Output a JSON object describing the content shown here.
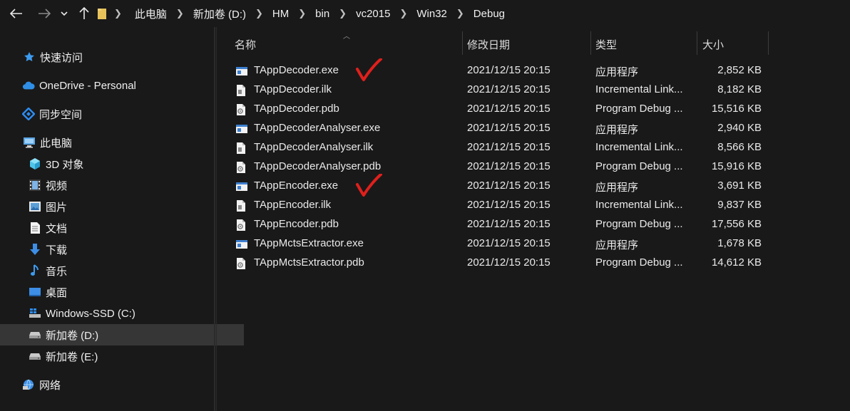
{
  "nav": {
    "back": "back-arrow-icon",
    "forward": "forward-arrow-icon",
    "recent": "chevron-down-icon",
    "up": "up-arrow-icon"
  },
  "breadcrumb": [
    "此电脑",
    "新加卷 (D:)",
    "HM",
    "bin",
    "vc2015",
    "Win32",
    "Debug"
  ],
  "sidebar": {
    "items": [
      {
        "label": "快速访问",
        "icon": "star-icon",
        "selected": false
      },
      {
        "label": "OneDrive - Personal",
        "icon": "cloud-icon",
        "selected": false
      },
      {
        "label": "同步空间",
        "icon": "sync-icon",
        "selected": false
      },
      {
        "label": "此电脑",
        "icon": "computer-icon",
        "selected": false
      },
      {
        "label": "3D 对象",
        "icon": "cube-icon",
        "selected": false
      },
      {
        "label": "视频",
        "icon": "video-icon",
        "selected": false
      },
      {
        "label": "图片",
        "icon": "picture-icon",
        "selected": false
      },
      {
        "label": "文档",
        "icon": "document-icon",
        "selected": false
      },
      {
        "label": "下载",
        "icon": "download-icon",
        "selected": false
      },
      {
        "label": "音乐",
        "icon": "music-icon",
        "selected": false
      },
      {
        "label": "桌面",
        "icon": "desktop-icon",
        "selected": false
      },
      {
        "label": "Windows-SSD (C:)",
        "icon": "windows-drive-icon",
        "selected": false
      },
      {
        "label": "新加卷 (D:)",
        "icon": "drive-icon",
        "selected": true
      },
      {
        "label": "新加卷 (E:)",
        "icon": "drive-icon",
        "selected": false
      },
      {
        "label": "网络",
        "icon": "network-icon",
        "selected": false
      }
    ]
  },
  "columns": {
    "name": "名称",
    "date": "修改日期",
    "type": "类型",
    "size": "大小"
  },
  "files": [
    {
      "name": "TAppDecoder.exe",
      "date": "2021/12/15 20:15",
      "type": "应用程序",
      "size": "2,852 KB",
      "icon": "exe-icon",
      "checked": true
    },
    {
      "name": "TAppDecoder.ilk",
      "date": "2021/12/15 20:15",
      "type": "Incremental Link...",
      "size": "8,182 KB",
      "icon": "ilk-file-icon",
      "checked": false
    },
    {
      "name": "TAppDecoder.pdb",
      "date": "2021/12/15 20:15",
      "type": "Program Debug ...",
      "size": "15,516 KB",
      "icon": "pdb-file-icon",
      "checked": false
    },
    {
      "name": "TAppDecoderAnalyser.exe",
      "date": "2021/12/15 20:15",
      "type": "应用程序",
      "size": "2,940 KB",
      "icon": "exe-icon",
      "checked": false
    },
    {
      "name": "TAppDecoderAnalyser.ilk",
      "date": "2021/12/15 20:15",
      "type": "Incremental Link...",
      "size": "8,566 KB",
      "icon": "ilk-file-icon",
      "checked": false
    },
    {
      "name": "TAppDecoderAnalyser.pdb",
      "date": "2021/12/15 20:15",
      "type": "Program Debug ...",
      "size": "15,916 KB",
      "icon": "pdb-file-icon",
      "checked": false
    },
    {
      "name": "TAppEncoder.exe",
      "date": "2021/12/15 20:15",
      "type": "应用程序",
      "size": "3,691 KB",
      "icon": "exe-icon",
      "checked": true
    },
    {
      "name": "TAppEncoder.ilk",
      "date": "2021/12/15 20:15",
      "type": "Incremental Link...",
      "size": "9,837 KB",
      "icon": "ilk-file-icon",
      "checked": false
    },
    {
      "name": "TAppEncoder.pdb",
      "date": "2021/12/15 20:15",
      "type": "Program Debug ...",
      "size": "17,556 KB",
      "icon": "pdb-file-icon",
      "checked": false
    },
    {
      "name": "TAppMctsExtractor.exe",
      "date": "2021/12/15 20:15",
      "type": "应用程序",
      "size": "1,678 KB",
      "icon": "exe-icon",
      "checked": false
    },
    {
      "name": "TAppMctsExtractor.pdb",
      "date": "2021/12/15 20:15",
      "type": "Program Debug ...",
      "size": "14,612 KB",
      "icon": "pdb-file-icon",
      "checked": false
    }
  ],
  "colors": {
    "background": "#191919",
    "selected": "#363636",
    "annotation": "#e0201c",
    "accent": "#2d8cf0"
  }
}
